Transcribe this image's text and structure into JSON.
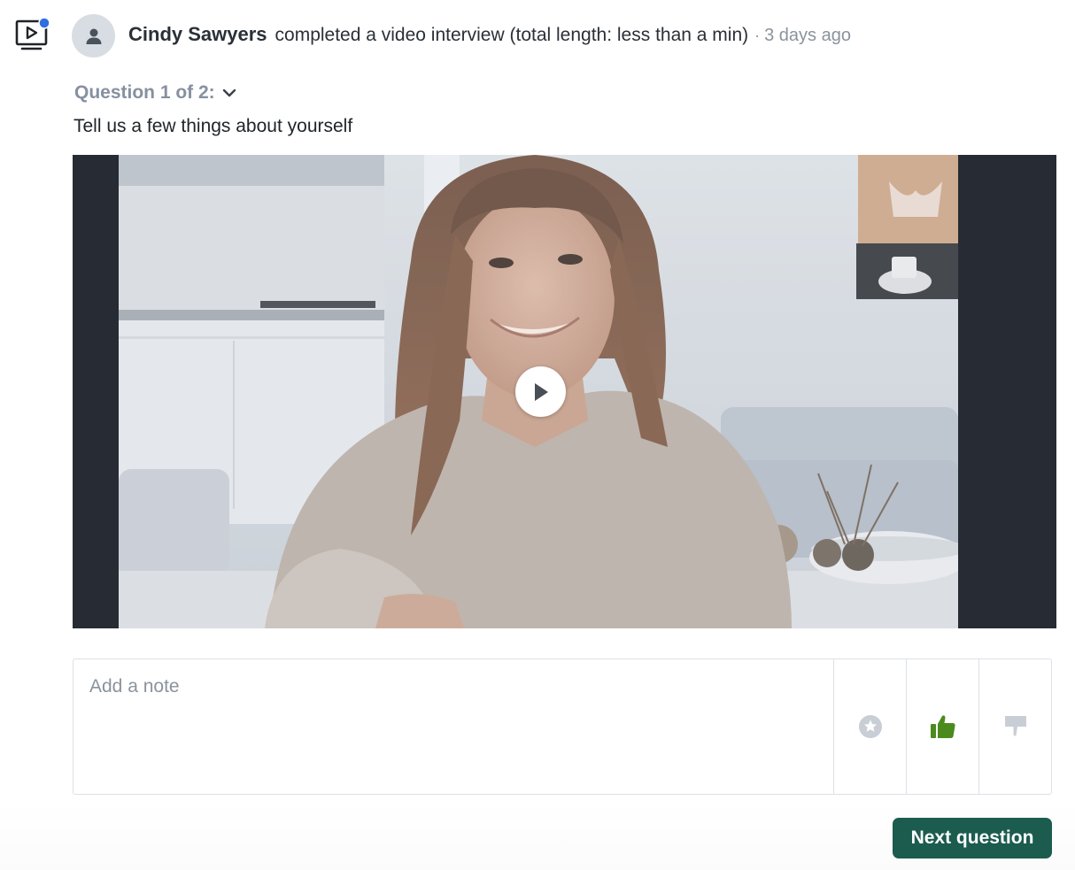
{
  "activity": {
    "icon": "video-interview-icon",
    "notification_dot_color": "#2f6fe0"
  },
  "header": {
    "avatar_icon": "user-icon",
    "user_name": "Cindy Sawyers",
    "action": "completed a video interview (total length: less than a min)",
    "separator": "·",
    "timestamp": "3 days ago"
  },
  "question": {
    "counter": "Question 1 of 2:",
    "text": "Tell us a few things about yourself"
  },
  "video": {
    "play_icon": "play-icon"
  },
  "note": {
    "value": "",
    "placeholder": "Add a note"
  },
  "ratings": {
    "star_icon": "star-icon",
    "thumbs_up_icon": "thumbs-up-icon",
    "thumbs_down_icon": "thumbs-down-icon",
    "thumbs_up_color": "#4b8b1e",
    "inactive_color": "#c9ced6"
  },
  "actions": {
    "next_label": "Next question",
    "next_color": "#1b5c4f"
  }
}
